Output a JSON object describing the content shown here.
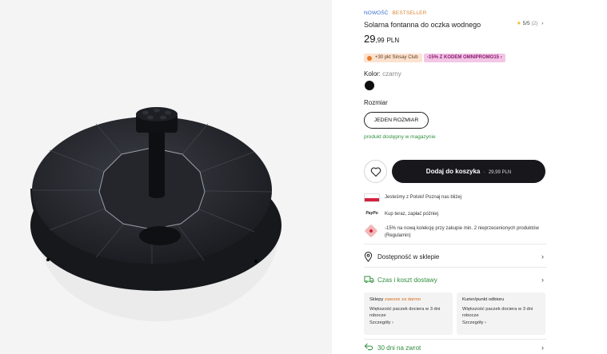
{
  "gallery": {
    "image_alt": "Solar fountain product photo"
  },
  "product": {
    "tag_new": "NOWOŚĆ",
    "tag_bestseller": "BESTSELLER",
    "rating": "5/5",
    "rating_count": "(2)",
    "title": "Solarna fontanna do oczka wodnego",
    "price_int": "29",
    "price_dec": ",99",
    "currency": "PLN"
  },
  "badges": {
    "club": "+30 pkt Sinsay Club",
    "promo": "-15% Z KODEM OMNIPROMO15",
    "promo_chevron": "›"
  },
  "color": {
    "label": "Kolor:",
    "value": "czarny",
    "swatch_hex": "#0e0e0e"
  },
  "size": {
    "label": "Rozmiar",
    "option": "JEDEN ROZMIAR"
  },
  "stock": "produkt dostępny w magazynie",
  "cart": {
    "label": "Dodaj do koszyka",
    "price": "29,99 PLN",
    "separator": "·"
  },
  "info": [
    {
      "text": "Jesteśmy z Polski! Poznaj nas bliżej"
    },
    {
      "icon_text": "PayPo",
      "text": "Kup teraz, zapłać później"
    },
    {
      "text": "-15% na nową kolekcję przy zakupie min. 2 nieprzecenionych produktów (Regulamin)"
    }
  ],
  "links": {
    "store": "Dostępność w sklepie",
    "delivery": "Czas i koszt dostawy",
    "returns": "30 dni na zwrot",
    "chevron": "›"
  },
  "delivery_cards": [
    {
      "title": "Sklepy",
      "note": "zawsze za darmo",
      "body": "Większość paczek dociera w 3 dni robocze",
      "more": "Szczegóły ›"
    },
    {
      "title": "Kurier/punkt odbioru",
      "note": "",
      "body": "Większość paczek dociera w 3 dni robocze",
      "more": "Szczegóły ›"
    }
  ],
  "colors": {
    "accent_dark": "#17171c",
    "stock_green": "#2f8f3c",
    "tag_blue": "#3b6fd1",
    "tag_orange": "#d9893a"
  }
}
